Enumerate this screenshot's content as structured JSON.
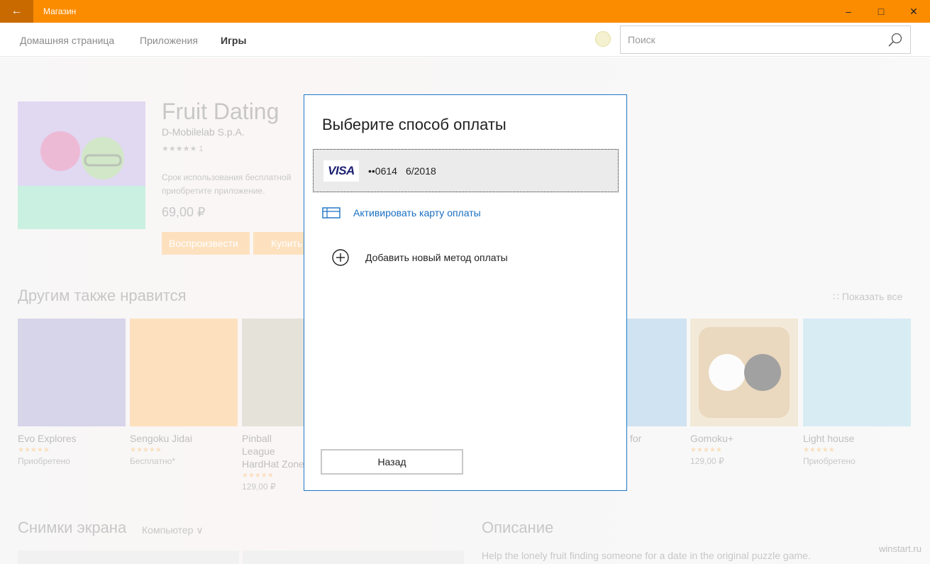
{
  "window": {
    "title": "Магазин",
    "back_glyph": "←",
    "minimize_glyph": "–",
    "maximize_glyph": "□",
    "close_glyph": "✕"
  },
  "nav": {
    "items": [
      "Домашняя страница",
      "Приложения",
      "Игры"
    ],
    "active_item": "Игры",
    "search_placeholder": "Поиск"
  },
  "app": {
    "title": "Fruit Dating",
    "publisher": "D-Mobilelab S.p.A.",
    "rating_text": "★★★★★ 1",
    "description": "Срок использования бесплатной приобретите приложение.",
    "price": "69,00 ₽",
    "play_label": "Воспроизвести",
    "buy_label": "Купить"
  },
  "also_like": {
    "title": "Другим также нравится",
    "show_all": "Показать все",
    "items": [
      {
        "name": "Evo Explores",
        "stars": "★★★★★",
        "status": "Приобретено"
      },
      {
        "name": "Sengoku Jidai",
        "stars": "★★★★★",
        "status": "Бесплатно*"
      },
      {
        "name": "Pinball League HardHat Zone",
        "stars": "★★★★★",
        "status": "129,00 ₽"
      },
      {
        "name": "for",
        "stars": "",
        "status": ""
      },
      {
        "name": "Gomoku+",
        "stars": "★★★★★",
        "status": "129,00 ₽"
      },
      {
        "name": "Light house",
        "stars": "★★★★★",
        "status": "Приобретено"
      }
    ]
  },
  "screenshots": {
    "title": "Снимки экрана",
    "device": "Компьютер"
  },
  "description": {
    "title": "Описание",
    "text": "Help the lonely fruit finding someone for a date in the original puzzle game."
  },
  "watermark": "winstart.ru",
  "dialog": {
    "title": "Выберите способ оплаты",
    "card_brand": "VISA",
    "card_number": "••0614",
    "card_expiry": "6/2018",
    "activate_label": "Активировать карту оплаты",
    "add_label": "Добавить новый метод оплаты",
    "back_label": "Назад"
  },
  "colors": {
    "accent": "#fb8c00",
    "link": "#1a6fc2",
    "dialog_border": "#1e78c8"
  }
}
